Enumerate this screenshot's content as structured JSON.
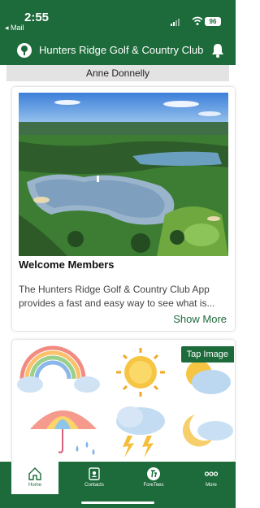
{
  "status_bar": {
    "time": "2:55",
    "back_label": "◂ Mail",
    "battery": "96"
  },
  "header": {
    "title": "Hunters Ridge Golf & Country Club",
    "logo_icon": "club-logo-icon",
    "bell_icon": "bell-icon"
  },
  "member_name": "Anne Donnelly",
  "welcome_card": {
    "heading": "Welcome Members",
    "description": "The Hunters Ridge Golf & Country Club App provides a fast and easy way to see what is...",
    "show_more": "Show More"
  },
  "weather_card": {
    "tap_label": "Tap Image"
  },
  "tabs": [
    {
      "label": "Home",
      "icon": "home-icon",
      "active": true
    },
    {
      "label": "Contacts",
      "icon": "contacts-icon",
      "active": false
    },
    {
      "label": "ForeTees",
      "icon": "foretees-icon",
      "active": false
    },
    {
      "label": "More",
      "icon": "more-icon",
      "active": false
    }
  ],
  "colors": {
    "brand_green": "#1d6b3b",
    "member_bar": "#e3e3e3",
    "link_green": "#1d6b3b"
  }
}
